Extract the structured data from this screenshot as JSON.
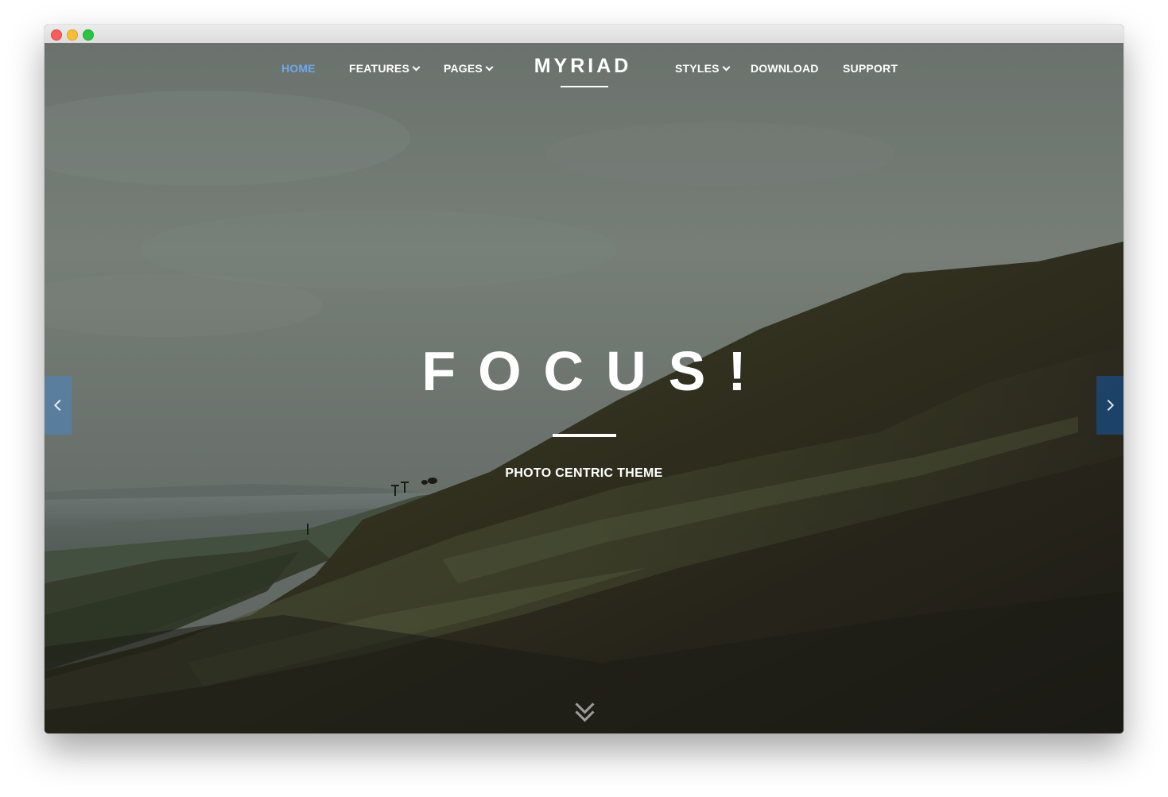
{
  "nav": {
    "left_items": [
      {
        "label": "HOME",
        "active": true,
        "has_dropdown": false
      },
      {
        "label": "FEATURES",
        "active": false,
        "has_dropdown": true
      },
      {
        "label": "PAGES",
        "active": false,
        "has_dropdown": true
      }
    ],
    "right_items": [
      {
        "label": "STYLES",
        "active": false,
        "has_dropdown": true
      },
      {
        "label": "DOWNLOAD",
        "active": false,
        "has_dropdown": false
      },
      {
        "label": "SUPPORT",
        "active": false,
        "has_dropdown": false
      }
    ],
    "logo": "MYRIAD",
    "active_color": "#6aa9e9"
  },
  "hero": {
    "headline": "FOCUS!",
    "subtitle": "PHOTO CENTRIC THEME"
  },
  "controls": {
    "prev_icon": "chevron-left-icon",
    "next_icon": "chevron-right-icon",
    "scroll_icon": "double-chevron-down-icon"
  }
}
